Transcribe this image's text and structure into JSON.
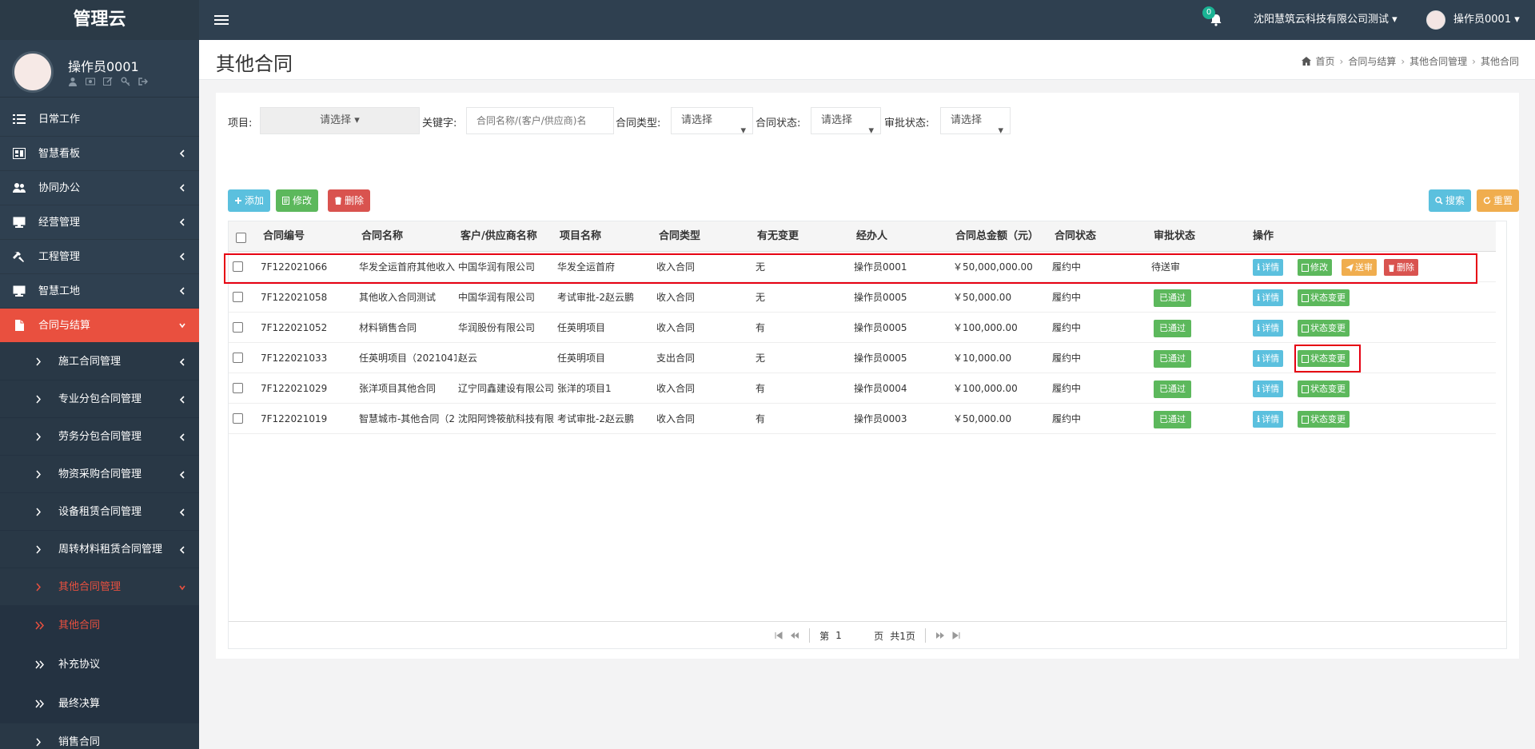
{
  "app": {
    "brand": "管理云"
  },
  "topbar": {
    "notification_count": "0",
    "company": "沈阳慧筑云科技有限公司测试 ▾",
    "user": "操作员0001 ▾"
  },
  "profile": {
    "name": "操作员0001"
  },
  "sidebar": {
    "items": [
      {
        "label": "日常工作",
        "icon": "list-icon"
      },
      {
        "label": "智慧看板",
        "icon": "dashboard-icon"
      },
      {
        "label": "协同办公",
        "icon": "users-icon"
      },
      {
        "label": "经营管理",
        "icon": "desktop-icon"
      },
      {
        "label": "工程管理",
        "icon": "hammer-icon"
      },
      {
        "label": "智慧工地",
        "icon": "desktop-icon"
      },
      {
        "label": "合同与结算",
        "icon": "file-icon"
      }
    ],
    "sub_items": [
      "施工合同管理",
      "专业分包合同管理",
      "劳务分包合同管理",
      "物资采购合同管理",
      "设备租赁合同管理",
      "周转材料租赁合同管理",
      "其他合同管理"
    ],
    "sub2_items": [
      "其他合同",
      "补充协议",
      "最终决算",
      "销售合同"
    ]
  },
  "page": {
    "title": "其他合同"
  },
  "breadcrumb": {
    "home": "首页",
    "level1": "合同与结算",
    "level2": "其他合同管理",
    "current": "其他合同"
  },
  "filters": {
    "project_label": "项目:",
    "project_value": "请选择",
    "keyword_label": "关键字:",
    "keyword_placeholder": "合同名称/(客户/供应商)名",
    "type_label": "合同类型:",
    "type_value": "请选择",
    "status_label": "合同状态:",
    "status_value": "请选择",
    "approval_label": "审批状态:",
    "approval_value": "请选择"
  },
  "toolbar": {
    "add": "添加",
    "edit": "修改",
    "delete": "删除",
    "search": "搜索",
    "reset": "重置"
  },
  "table": {
    "columns": [
      "合同编号",
      "合同名称",
      "客户/供应商名称",
      "项目名称",
      "合同类型",
      "有无变更",
      "经办人",
      "合同总金额（元）",
      "合同状态",
      "审批状态",
      "操作"
    ],
    "rows": [
      {
        "code": "7F122021066",
        "name": "华发全运首府其他收入",
        "partner": "中国华润有限公司",
        "project": "华发全运首府",
        "type": "收入合同",
        "changed": "无",
        "handler": "操作员0001",
        "amount": "￥50,000,000.00",
        "status": "履约中",
        "approval": "待送审",
        "actions": [
          "详情",
          "修改",
          "送审",
          "删除"
        ]
      },
      {
        "code": "7F122021058",
        "name": "其他收入合同测试",
        "partner": "中国华润有限公司",
        "project": "考试审批-2赵云鹏",
        "type": "收入合同",
        "changed": "无",
        "handler": "操作员0005",
        "amount": "￥50,000.00",
        "status": "履约中",
        "approval": "已通过",
        "actions": [
          "详情",
          "状态变更"
        ]
      },
      {
        "code": "7F122021052",
        "name": "材料销售合同",
        "partner": "华润股份有限公司",
        "project": "任英明项目",
        "type": "收入合同",
        "changed": "有",
        "handler": "操作员0005",
        "amount": "￥100,000.00",
        "status": "履约中",
        "approval": "已通过",
        "actions": [
          "详情",
          "状态变更"
        ]
      },
      {
        "code": "7F122021033",
        "name": "任英明项目（2021041",
        "partner": "赵云",
        "project": "任英明项目",
        "type": "支出合同",
        "changed": "无",
        "handler": "操作员0005",
        "amount": "￥10,000.00",
        "status": "履约中",
        "approval": "已通过",
        "actions": [
          "详情",
          "状态变更"
        ]
      },
      {
        "code": "7F122021029",
        "name": "张洋项目其他合同",
        "partner": "辽宁同鑫建设有限公司",
        "project": "张洋的项目1",
        "type": "收入合同",
        "changed": "有",
        "handler": "操作员0004",
        "amount": "￥100,000.00",
        "status": "履约中",
        "approval": "已通过",
        "actions": [
          "详情",
          "状态变更"
        ]
      },
      {
        "code": "7F122021019",
        "name": "智慧城市-其他合同（2",
        "partner": "沈阳阿馋筱航科技有限",
        "project": "考试审批-2赵云鹏",
        "type": "收入合同",
        "changed": "有",
        "handler": "操作员0003",
        "amount": "￥50,000.00",
        "status": "履约中",
        "approval": "已通过",
        "actions": [
          "详情",
          "状态变更"
        ]
      }
    ]
  },
  "pagination": {
    "page_prefix": "第",
    "page": "1",
    "page_suffix": "页",
    "total": "共1页"
  },
  "colors": {
    "sidebar_bg": "#2f4050",
    "active": "#e9503f",
    "info": "#5bc0de",
    "success": "#5cb85c",
    "danger": "#d9534f",
    "warning": "#f0ad4e",
    "highlight": "#e60012"
  }
}
